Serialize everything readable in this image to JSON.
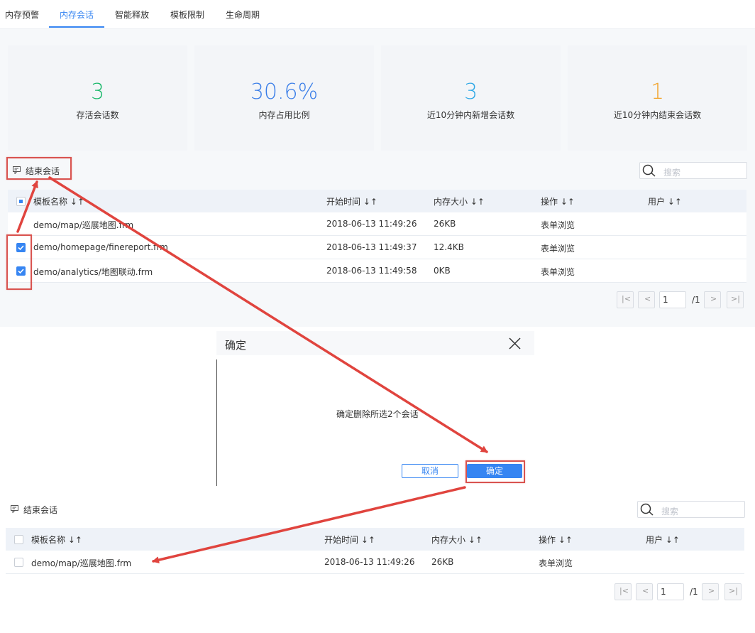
{
  "tabs": [
    "内存预警",
    "内存会话",
    "智能释放",
    "模板限制",
    "生命周期"
  ],
  "stats": [
    {
      "value": "3",
      "label": "存活会话数",
      "color": "#19b86a"
    },
    {
      "value": "30.6%",
      "label": "内存占用比例",
      "color": "#3a7ee8"
    },
    {
      "value": "3",
      "label": "近10分钟内新增会话数",
      "color": "#2fa8e6"
    },
    {
      "value": "1",
      "label": "近10分钟内结束会话数",
      "color": "#f2a32b"
    }
  ],
  "toolbar": {
    "end_session": "结束会话",
    "search_placeholder": "搜索"
  },
  "columns": [
    "模板名称",
    "开始时间",
    "内存大小",
    "操作",
    "用户"
  ],
  "sort_icon": "↓↑",
  "table_before": [
    {
      "name": "demo/map/巡展地图.frm",
      "start": "2018-06-13 11:49:26",
      "size": "26KB",
      "op": "表单浏览",
      "user": "",
      "checked": false
    },
    {
      "name": "demo/homepage/finereport.frm",
      "start": "2018-06-13 11:49:37",
      "size": "12.4KB",
      "op": "表单浏览",
      "user": "",
      "checked": true
    },
    {
      "name": "demo/analytics/地图联动.frm",
      "start": "2018-06-13 11:49:58",
      "size": "0KB",
      "op": "表单浏览",
      "user": "",
      "checked": true
    }
  ],
  "table_after": [
    {
      "name": "demo/map/巡展地图.frm",
      "start": "2018-06-13 11:49:26",
      "size": "26KB",
      "op": "表单浏览",
      "user": ""
    }
  ],
  "pagination": {
    "page": "1",
    "total": "/1"
  },
  "dialog": {
    "title": "确定",
    "message": "确定删除所选2个会话",
    "cancel": "取消",
    "confirm": "确定"
  },
  "accent_color": "#3685f2",
  "annotation_color": "#d9534f"
}
